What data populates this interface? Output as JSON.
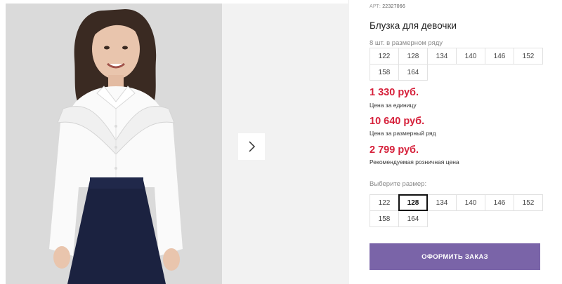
{
  "product": {
    "art_label": "АРТ:",
    "art_value": "22327066",
    "title": "Блузка для девочки",
    "pack_label": "8 шт. в размерном ряду",
    "pack_sizes": [
      "122",
      "128",
      "134",
      "140",
      "146",
      "152",
      "158",
      "164"
    ]
  },
  "prices": {
    "unit_price": "1 330 руб.",
    "unit_label": "Цена за единицу",
    "range_price": "10 640 руб.",
    "range_label": "Цена за размерный ряд",
    "retail_price": "2 799 руб.",
    "retail_label": "Рекомендуемая розничная цена"
  },
  "size_select": {
    "label": "Выберите размер:",
    "sizes": [
      "122",
      "128",
      "134",
      "140",
      "146",
      "152",
      "158",
      "164"
    ],
    "selected": "128"
  },
  "order_button": "ОФОРМИТЬ ЗАКАЗ",
  "icons": {
    "next": "chevron-right-icon"
  },
  "colors": {
    "price": "#d6213b",
    "order_button": "#7a64a8"
  }
}
